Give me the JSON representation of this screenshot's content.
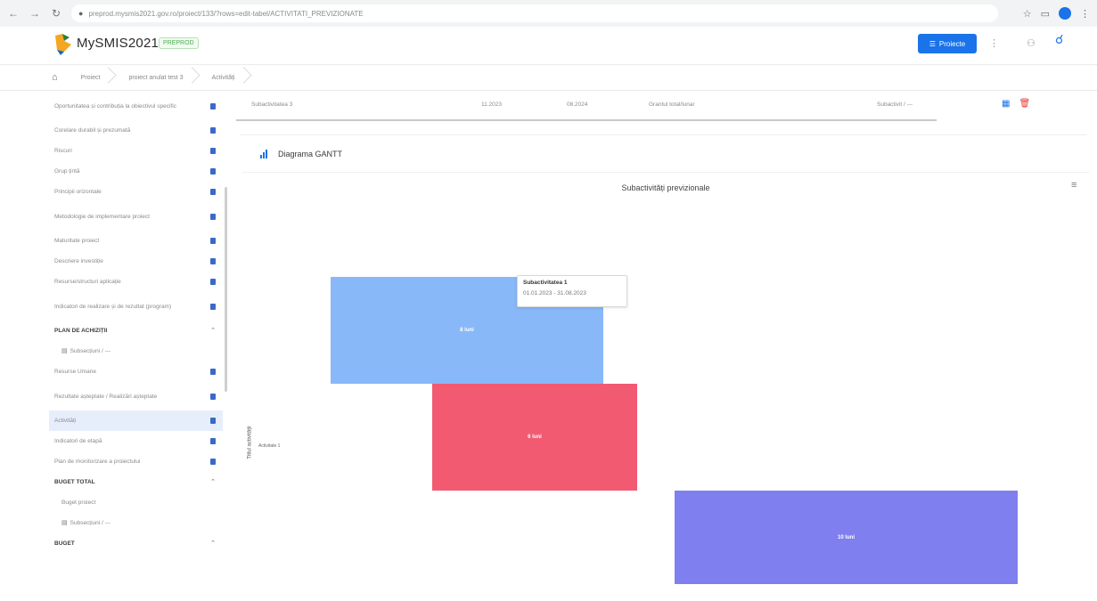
{
  "browser": {
    "url": "preprod.mysmis2021.gov.ro/proiect/133/?rows=edit-tabel/ACTIVITATI_PREVIZIONATE",
    "icons": [
      "back-icon",
      "forward-icon",
      "reload-icon",
      "lock-icon",
      "star-icon",
      "extensions-icon",
      "profile-icon",
      "menu-icon"
    ]
  },
  "header": {
    "brand": "MySMIS2021",
    "env_badge": "PREPROD",
    "projects_button": "Proiecte",
    "brand_color": "#f5a623",
    "accent": "#1a73e8"
  },
  "breadcrumb": {
    "items": [
      "Proiect",
      "proiect anulat test 3",
      "Activități"
    ]
  },
  "sidebar": {
    "items": [
      {
        "label": "Oportunitatea și contribuția la obiectivul specific",
        "type": "double"
      },
      {
        "label": "Corelare durabil și prezumată",
        "type": "single"
      },
      {
        "label": "Riscuri",
        "type": "single"
      },
      {
        "label": "Grup țintă",
        "type": "single"
      },
      {
        "label": "Principii orizontale",
        "type": "single"
      },
      {
        "label": "Metodologie de implementare proiect",
        "type": "double"
      },
      {
        "label": "Maturitate proiect",
        "type": "single"
      },
      {
        "label": "Descriere investiție",
        "type": "single"
      },
      {
        "label": "Resurse/structuri aplicație",
        "type": "single"
      },
      {
        "label": "Indicatori de realizare și de rezultat (program)",
        "type": "double"
      }
    ],
    "section1": "PLAN DE ACHIZIȚII",
    "section1_sub": "Subsecțiuni / ---",
    "items2": [
      {
        "label": "Resurse Umane",
        "type": "single"
      },
      {
        "label": "Rezultate așteptate / Realizări așteptate",
        "type": "double"
      },
      {
        "label": "Activități",
        "type": "single",
        "active": true
      },
      {
        "label": "Indicatori de etapă",
        "type": "single"
      },
      {
        "label": "Plan de monitorizare a proiectului",
        "type": "single"
      }
    ],
    "section2": "BUGET TOTAL",
    "section2_items": [
      "Buget proiect",
      "Subsecțiuni / ---"
    ],
    "section3": "BUGET"
  },
  "row": {
    "name": "Subactivitatea 3",
    "start": "11.2023",
    "end": "08.2024",
    "type": "Grantul total/lunar",
    "sub": "Subactivit / ---"
  },
  "card": {
    "title": "Diagrama GANTT"
  },
  "chart_data": {
    "type": "gantt",
    "title": "Subactivități previzionale",
    "ylabel": "Titlul activității",
    "categories": [
      "Activitate 1"
    ],
    "bars": [
      {
        "label": "8 luni",
        "color": "#88b8f8"
      },
      {
        "label": "6 luni",
        "color": "#f25a72"
      },
      {
        "label": "10 luni",
        "color": "#7f7ff0"
      }
    ],
    "tooltip": {
      "title": "Subactivitatea 1",
      "dates": "01.01.2023 - 31.08.2023"
    }
  }
}
